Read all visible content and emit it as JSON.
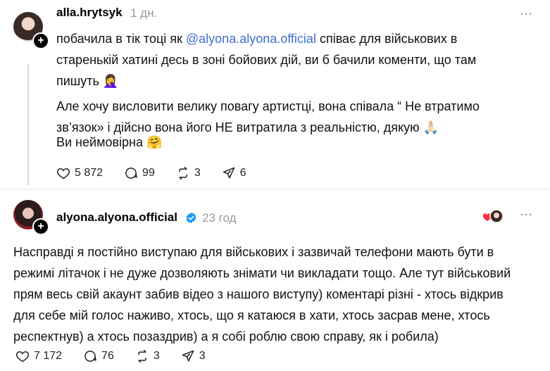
{
  "post1": {
    "username": "alla.hrytsyk",
    "time": "1 дн.",
    "text_before_mention": "побачила в тік тоці як ",
    "mention": "@alyona.alyona.official",
    "text_after_mention": " співає для військових в старенькій хатині десь в зоні бойових дій, ви б бачили коменти, що там пишуть 🤦‍♀️",
    "paragraph2": "Але хочу висловити велику повагу артистці, вона співала “ Не втратимо зв’язок» і дійсно вона його НЕ витратила з реальністю, дякую 🙏🏻",
    "paragraph3": "Ви неймовірна 🤗",
    "likes": "5 872",
    "comments": "99",
    "reposts": "3",
    "shares": "6"
  },
  "post2": {
    "username": "alyona.alyona.official",
    "time": "23 год",
    "text": "Насправді я постійно виступаю для військових і зазвичай телефони мають бути в режимі літачок і не дуже дозволяють знімати чи викладати тощо. Але тут військовий прям весь свій акаунт забив відео з нашого виступу) коментарі різні - хтось відкрив для себе мій голос наживо, хтось, що я катаюся в хати, хтось засрав мене, хтось респектнув) а хтось позаздрив) а я собі роблю свою справу, як і робила)",
    "likes": "7 172",
    "comments": "76",
    "reposts": "3",
    "shares": "3"
  },
  "ui": {
    "more_label": "···",
    "follow_label": "+"
  }
}
